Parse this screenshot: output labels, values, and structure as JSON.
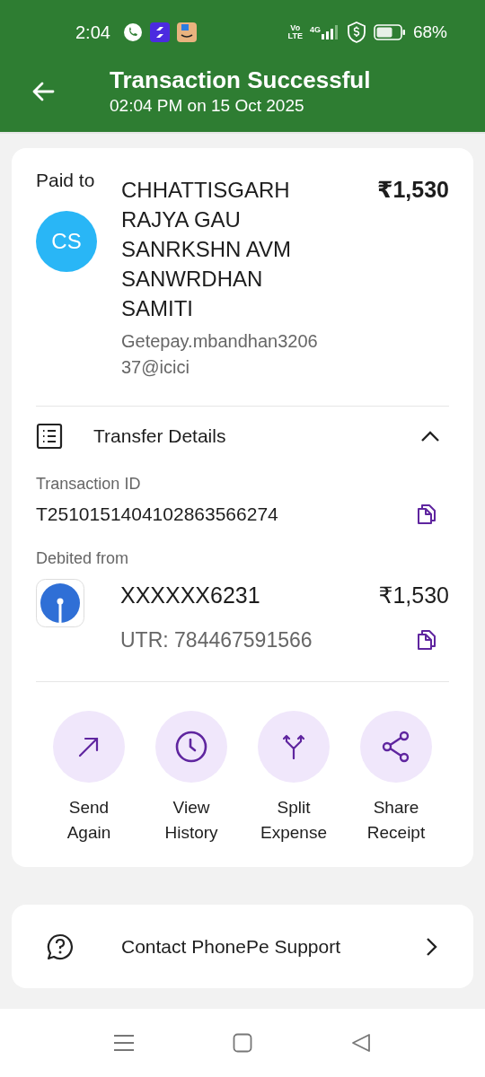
{
  "status_bar": {
    "time": "2:04",
    "volte_top": "Vo",
    "volte_bottom": "LTE",
    "network": "4G",
    "battery_percent": "68%"
  },
  "header": {
    "title": "Transaction Successful",
    "subtitle": "02:04 PM on 15 Oct 2025"
  },
  "payment": {
    "label": "Paid to",
    "avatar_initials": "CS",
    "payee_name": "CHHATTISGARH RAJYA GAU SANRKSHN AVM SANWRDHAN SAMITI",
    "payee_vpa": "Getepay.mbandhan320637@icici",
    "amount": "₹1,530"
  },
  "transfer_details": {
    "title": "Transfer Details",
    "expanded": true,
    "transaction_id_label": "Transaction ID",
    "transaction_id": "T2510151404102863566274",
    "debited_label": "Debited from",
    "account": "XXXXXX6231",
    "debited_amount": "₹1,530",
    "utr": "UTR: 784467591566"
  },
  "actions": [
    {
      "kind": "send",
      "line1": "Send",
      "line2": "Again"
    },
    {
      "kind": "history",
      "line1": "View",
      "line2": "History"
    },
    {
      "kind": "split",
      "line1": "Split",
      "line2": "Expense"
    },
    {
      "kind": "share",
      "line1": "Share",
      "line2": "Receipt"
    }
  ],
  "support": {
    "label": "Contact PhonePe Support"
  }
}
